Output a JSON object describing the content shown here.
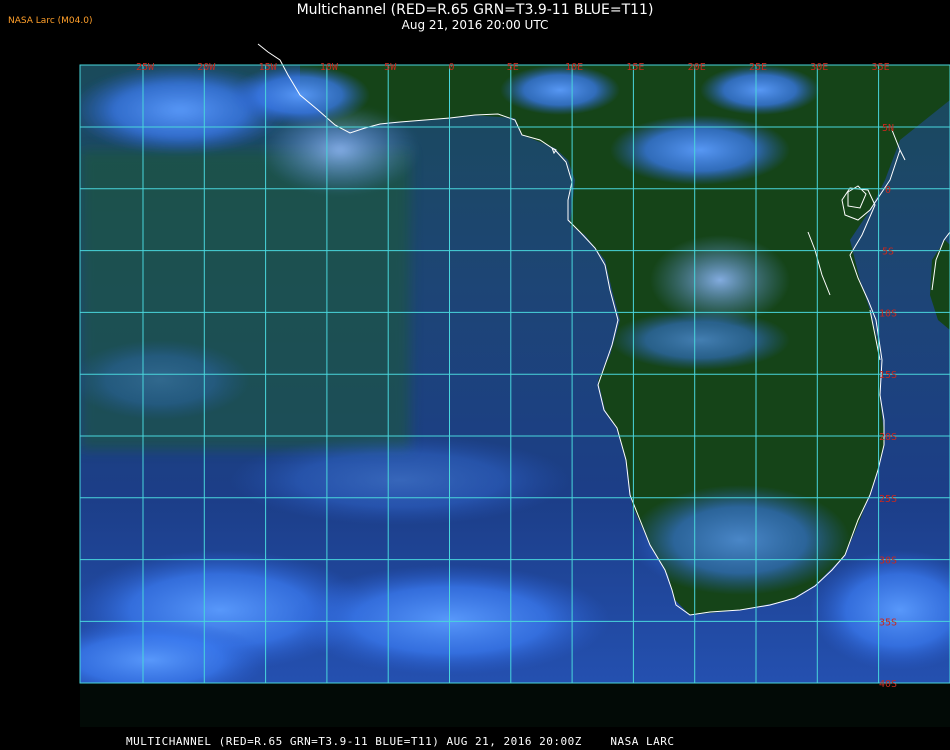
{
  "header": {
    "credit": "NASA Larc (M04.0)",
    "title": "Multichannel (RED=R.65 GRN=T3.9-11 BLUE=T11)",
    "subtitle": "Aug 21, 2016 20:00 UTC"
  },
  "map": {
    "longitude_labels": [
      "25W",
      "20W",
      "15W",
      "10W",
      "5W",
      "0",
      "5E",
      "10E",
      "15E",
      "20E",
      "25E",
      "30E",
      "35E"
    ],
    "latitude_labels": [
      "5N",
      "0",
      "5S",
      "10S",
      "15S",
      "20S",
      "25S",
      "30S",
      "35S",
      "40S"
    ],
    "colors": {
      "gridline": "#49d6dc",
      "coastline": "#ffffff",
      "grid_label": "#c8281e",
      "ocean": "#1a3f86",
      "land": "#154418",
      "cloud": "#3f86ff"
    }
  },
  "footer": {
    "caption": "MULTICHANNEL (RED=R.65 GRN=T3.9-11 BLUE=T11) AUG 21, 2016 20:00Z    NASA LARC"
  }
}
